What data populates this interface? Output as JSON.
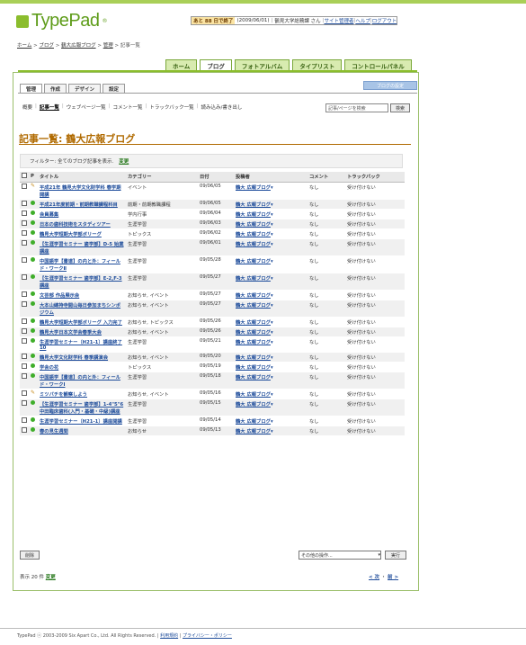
{
  "app": {
    "logo_text": "TypePad",
    "logo_mark": "®"
  },
  "userbar": {
    "days": "あと 88 日で終了",
    "date": "(2009/06/01)",
    "user": "鶴見大学総務課 さん",
    "links": [
      "サイト管理者",
      "ヘルプ",
      "ログアウト"
    ]
  },
  "breadcrumb": [
    "ホーム",
    "ブログ",
    "鶴大広報ブログ",
    "管理",
    "記事一覧"
  ],
  "topnav": [
    {
      "label": "ホーム",
      "active": false
    },
    {
      "label": "ブログ",
      "active": true
    },
    {
      "label": "フォトアルバム",
      "active": false
    },
    {
      "label": "タイプリスト",
      "active": false
    },
    {
      "label": "コントロールパネル",
      "active": false
    }
  ],
  "blog_settings_label": "ブログの設定",
  "subtabs": [
    {
      "label": "管理",
      "active": true
    },
    {
      "label": "作成",
      "active": false
    },
    {
      "label": "デザイン",
      "active": false
    },
    {
      "label": "設定",
      "active": false
    }
  ],
  "submenu": [
    {
      "label": "概要",
      "current": false
    },
    {
      "label": "記事一覧",
      "current": true
    },
    {
      "label": "ウェブページ一覧",
      "current": false
    },
    {
      "label": "コメント一覧",
      "current": false
    },
    {
      "label": "トラックバック一覧",
      "current": false
    },
    {
      "label": "読み込み/書き出し",
      "current": false
    }
  ],
  "search": {
    "placeholder": "記事/ページを検索",
    "button": "検索"
  },
  "page_title": "記事一覧: 鶴大広報ブログ",
  "filter": {
    "text": "フィルター: 全てのブログ記事を表示.",
    "link": "変更"
  },
  "table": {
    "headers": [
      "",
      "P",
      "タイトル",
      "カテゴリー",
      "日付",
      "投稿者",
      "コメント",
      "トラックバック"
    ],
    "rows": [
      {
        "status": "draft",
        "title": "平成21年 鶴見大学文化財学科 春学期開講",
        "category": "イベント",
        "date": "09/06/05",
        "author": "鶴大 広報ブログ",
        "comments": "なし",
        "trackbacks": "受け付けない"
      },
      {
        "status": "published",
        "title": "平成21年度前期・前期教職課程科目",
        "category": "前期・前期教職課程",
        "date": "09/06/05",
        "author": "鶴大 広報ブログ",
        "comments": "なし",
        "trackbacks": "受け付けない"
      },
      {
        "status": "published",
        "title": "会員募集",
        "category": "学内行事",
        "date": "09/06/04",
        "author": "鶴大 広報ブログ",
        "comments": "なし",
        "trackbacks": "受け付けない"
      },
      {
        "status": "published",
        "title": "日本の歯科技術をスタディツアー",
        "category": "生涯学習",
        "date": "09/06/03",
        "author": "鶴大 広報ブログ",
        "comments": "なし",
        "trackbacks": "受け付けない"
      },
      {
        "status": "published",
        "title": "鶴見大学短期大学部ボリーグ",
        "category": "トピックス",
        "date": "09/06/02",
        "author": "鶴大 広報ブログ",
        "comments": "なし",
        "trackbacks": "受け付けない"
      },
      {
        "status": "published",
        "title": "【生涯学習セミナー 歯学部】D-5 始業講座",
        "category": "生涯学習",
        "date": "09/06/01",
        "author": "鶴大 広報ブログ",
        "comments": "なし",
        "trackbacks": "受け付けない"
      },
      {
        "status": "published",
        "title": "中国語学【書道】の内と外：フィールド・ワークⅡ",
        "category": "生涯学習",
        "date": "09/05/28",
        "author": "鶴大 広報ブログ",
        "comments": "なし",
        "trackbacks": "受け付けない"
      },
      {
        "status": "published",
        "title": "【生涯学習セミナー 歯学部】E-2,F-3講座",
        "category": "生涯学習",
        "date": "09/05/27",
        "author": "鶴大 広報ブログ",
        "comments": "なし",
        "trackbacks": "受け付けない"
      },
      {
        "status": "published",
        "title": "文芸部 作品展示会",
        "category": "お知らせ, イベント",
        "date": "09/05/27",
        "author": "鶴大 広報ブログ",
        "comments": "なし",
        "trackbacks": "受け付けない"
      },
      {
        "status": "published",
        "title": "大本山總持寺開山毎日参加まちシンポジウム",
        "category": "お知らせ, イベント",
        "date": "09/05/27",
        "author": "鶴大 広報ブログ",
        "comments": "なし",
        "trackbacks": "受け付けない"
      },
      {
        "status": "published",
        "title": "鶴見大学短期大学部ボリーグ 入力完了",
        "category": "お知らせ, トピックス",
        "date": "09/05/26",
        "author": "鶴大 広報ブログ",
        "comments": "なし",
        "trackbacks": "受け付けない"
      },
      {
        "status": "published",
        "title": "鶴見大学日本文学会春季大会",
        "category": "お知らせ, イベント",
        "date": "09/05/26",
        "author": "鶴大 広報ブログ",
        "comments": "なし",
        "trackbacks": "受け付けない"
      },
      {
        "status": "published",
        "title": "生涯学習セミナー（H21-1）講座終了10",
        "category": "生涯学習",
        "date": "09/05/21",
        "author": "鶴大 広報ブログ",
        "comments": "なし",
        "trackbacks": "受け付けない"
      },
      {
        "status": "published",
        "title": "鶴見大学文化財学科 春季講演会",
        "category": "お知らせ, イベント",
        "date": "09/05/20",
        "author": "鶴大 広報ブログ",
        "comments": "なし",
        "trackbacks": "受け付けない"
      },
      {
        "status": "published",
        "title": "学会の花",
        "category": "トピックス",
        "date": "09/05/19",
        "author": "鶴大 広報ブログ",
        "comments": "なし",
        "trackbacks": "受け付けない"
      },
      {
        "status": "published",
        "title": "中国語学【書道】の内と外：フィールド・ワークⅠ",
        "category": "生涯学習",
        "date": "09/05/18",
        "author": "鶴大 広報ブログ",
        "comments": "なし",
        "trackbacks": "受け付けない"
      },
      {
        "status": "draft",
        "title": "ミツバチを観察しよう",
        "category": "お知らせ, イベント",
        "date": "09/05/16",
        "author": "鶴大 広報ブログ",
        "comments": "なし",
        "trackbacks": "受け付けない"
      },
      {
        "status": "published",
        "title": "【生涯学習セミナー 歯学部】1-4\"5\"6中田臨床歯科(入門・基礎・中級)講座",
        "category": "生涯学習",
        "date": "09/05/15",
        "author": "鶴大 広報ブログ",
        "comments": "なし",
        "trackbacks": "受け付けない"
      },
      {
        "status": "published",
        "title": "生涯学習セミナー（H21-1）講座開講",
        "category": "生涯学習",
        "date": "09/05/14",
        "author": "鶴大 広報ブログ",
        "comments": "なし",
        "trackbacks": "受け付けない"
      },
      {
        "status": "published",
        "title": "春の見生週間",
        "category": "お知らせ",
        "date": "09/05/13",
        "author": "鶴大 広報ブログ",
        "comments": "なし",
        "trackbacks": "受け付けない"
      }
    ]
  },
  "actions": {
    "delete": "削除",
    "bulk_select": "その他の操作...",
    "execute": "実行"
  },
  "show_count": {
    "text": "表示 20 件",
    "link": "変更"
  },
  "pager": {
    "prev": "< 次",
    "sep": "・",
    "next": "前 >"
  },
  "footer": {
    "copyright": "TypePad ⓒ 2003-2009 Six Apart Co., Ltd. All Rights Reserved.",
    "links": [
      "利用規約",
      "プライバシー・ポリシー"
    ]
  }
}
